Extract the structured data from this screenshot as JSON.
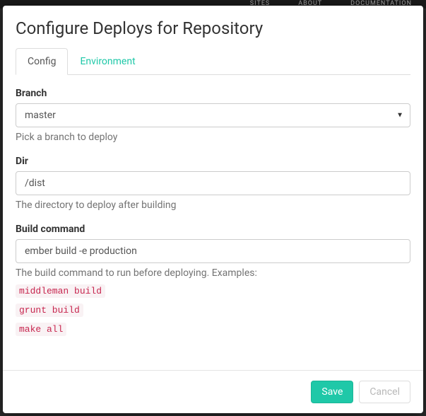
{
  "bg_nav": {
    "item1": "SITES",
    "item2": "ABOUT",
    "item3": "DOCUMENTATION"
  },
  "modal": {
    "title": "Configure Deploys for Repository"
  },
  "tabs": {
    "config": "Config",
    "environment": "Environment"
  },
  "form": {
    "branch": {
      "label": "Branch",
      "value": "master",
      "help": "Pick a branch to deploy"
    },
    "dir": {
      "label": "Dir",
      "value": "/dist",
      "help": "The directory to deploy after building"
    },
    "build": {
      "label": "Build command",
      "value": "ember build -e production",
      "help": "The build command to run before deploying. Examples:",
      "examples": {
        "e1": "middleman build",
        "e2": "grunt build",
        "e3": "make all"
      }
    }
  },
  "footer": {
    "save": "Save",
    "cancel": "Cancel"
  }
}
